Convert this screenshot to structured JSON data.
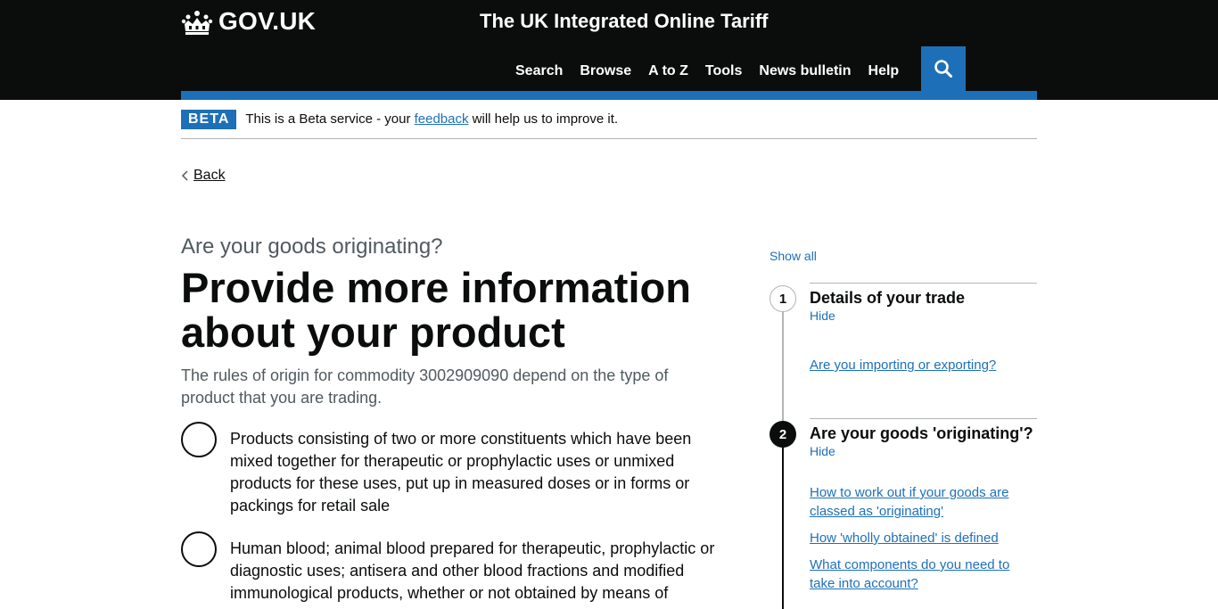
{
  "header": {
    "logo_text": "GOV.UK",
    "service_name": "The UK Integrated Online Tariff",
    "nav": [
      "Search",
      "Browse",
      "A to Z",
      "Tools",
      "News bulletin",
      "Help"
    ],
    "search_icon": "search-icon"
  },
  "beta": {
    "tag": "BETA",
    "text_before": "This is a Beta service - your ",
    "link": "feedback",
    "text_after": " will help us to improve it."
  },
  "back_label": "Back",
  "main": {
    "caption": "Are your goods originating?",
    "heading": "Provide more information about your product",
    "lead": "The rules of origin for commodity 3002909090 depend on the type of product that you are trading.",
    "options": [
      "Products consisting of two or more constituents which have been mixed together for therapeutic or prophylactic uses or unmixed products for these uses, put up in measured doses or in forms or packings for retail sale",
      "Human blood; animal blood prepared for therapeutic, prophylactic or diagnostic uses; antisera and other blood fractions and modified immunological products, whether or not obtained by means of"
    ]
  },
  "sidebar": {
    "show_all": "Show all",
    "steps": [
      {
        "number": "1",
        "title": "Details of your trade",
        "toggle": "Hide",
        "links": [
          "Are you importing or exporting?"
        ]
      },
      {
        "number": "2",
        "title": "Are your goods 'originating'?",
        "toggle": "Hide",
        "links": [
          "How to work out if your goods are classed as 'originating'",
          "How 'wholly obtained' is defined",
          "What components do you need to take into account?"
        ]
      }
    ]
  },
  "colors": {
    "header_bg": "#0b0c0c",
    "accent_blue": "#1d70b8",
    "secondary_text": "#505a5f"
  }
}
